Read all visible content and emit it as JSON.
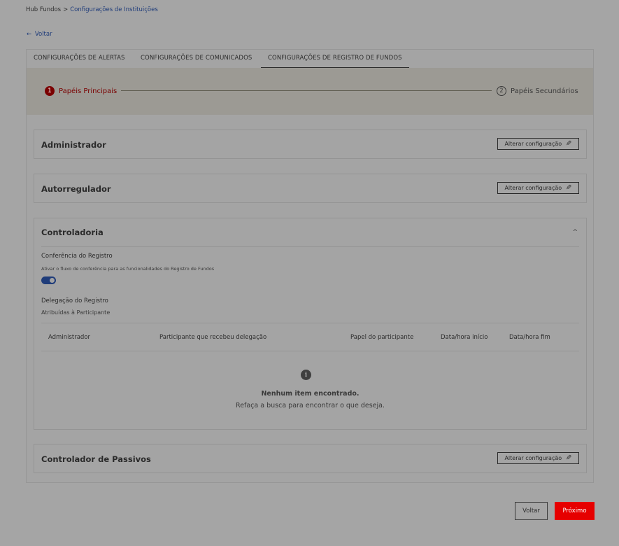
{
  "breadcrumb": {
    "root": "Hub Fundos",
    "separator": ">",
    "current": "Configurações de Instituições"
  },
  "back_link": {
    "arrow": "←",
    "label": "Voltar"
  },
  "tabs": [
    {
      "label": "CONFIGURAÇÕES DE ALERTAS"
    },
    {
      "label": "CONFIGURAÇÕES DE COMUNICADOS"
    },
    {
      "label": "CONFIGURAÇÕES DE REGISTRO DE FUNDOS"
    }
  ],
  "stepper": {
    "steps": [
      {
        "num": "1",
        "label": "Papéis Principais"
      },
      {
        "num": "2",
        "label": "Papéis Secundários"
      }
    ]
  },
  "cards": {
    "administrador": {
      "title": "Administrador",
      "button": "Alterar configuração"
    },
    "autorregulador": {
      "title": "Autorregulador",
      "button": "Alterar configuração"
    },
    "controladoria": {
      "title": "Controladoria",
      "chevron": "^",
      "conferencia_title": "Conferência do Registro",
      "conferencia_desc": "Ativar o fluxo de conferência para as funcionalidades do Registro de Fundos",
      "delegacao_title": "Delegação do Registro",
      "delegacao_desc": "Atribuídas à Participante",
      "table_headers": [
        "Administrador",
        "Participante que recebeu delegação",
        "Papel do participante",
        "Data/hora início",
        "Data/hora fim"
      ],
      "empty_icon": "i",
      "empty_title": "Nenhum item encontrado.",
      "empty_desc": "Refaça a busca para encontrar o que deseja."
    },
    "controlador_passivos": {
      "title": "Controlador de Passivos",
      "button": "Alterar configuração"
    }
  },
  "icons": {
    "pencil": "✎"
  },
  "footer": {
    "back": "Voltar",
    "next": "Próximo"
  },
  "colors": {
    "accent_red": "#e60000",
    "link_blue": "#1f3c7a",
    "step_active": "#7a0000"
  }
}
